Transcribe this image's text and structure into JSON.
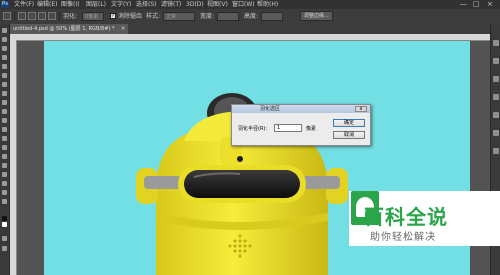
{
  "app": {
    "logo": "Ps"
  },
  "menu": [
    "文件(F)",
    "编辑(E)",
    "图像(I)",
    "图层(L)",
    "文字(Y)",
    "选择(S)",
    "滤镜(T)",
    "3D(D)",
    "视图(V)",
    "窗口(W)",
    "帮助(H)"
  ],
  "window_controls": [
    "—",
    "□",
    "×"
  ],
  "options": {
    "feather_label": "羽化:",
    "feather_value": "0像素",
    "antialias_label": "消除锯齿",
    "antialias_checked": true,
    "style_label": "样式:",
    "style_value": "正常",
    "width_label": "宽度:",
    "height_label": "高度:",
    "refine_edge_button": "调整边缘..."
  },
  "document_tab": {
    "label": "untitled-4.psd @ 50% (图层 1, RGB/8#) *",
    "close": "×"
  },
  "canvas": {
    "background": "#72dfe5",
    "robot_body": "#f2e630",
    "robot_dark": "#1f1f1f"
  },
  "dialog": {
    "title": "羽化选区",
    "close_label": "x",
    "field_label": "羽化半径(R):",
    "field_value": "1",
    "unit": "像素",
    "ok_label": "确定",
    "cancel_label": "取消"
  },
  "watermark": {
    "title": "百科全说",
    "subtitle": "助你轻松解决",
    "brand_color": "#2aa54a"
  }
}
